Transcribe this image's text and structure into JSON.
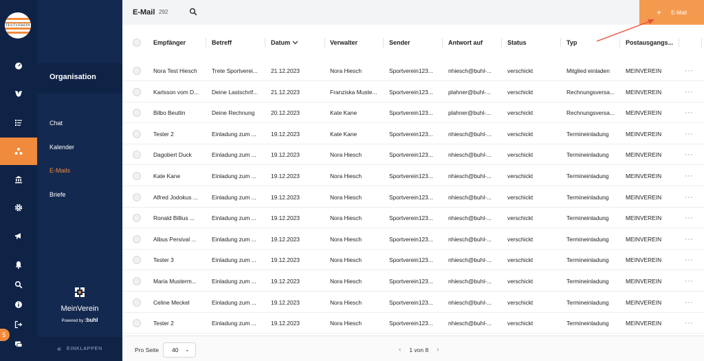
{
  "rail": {
    "logo_text": "TESTVEREIN",
    "badge": "5",
    "icons": [
      "dashboard-icon",
      "members-icon",
      "list-icon",
      "organisation-icon",
      "bank-icon",
      "settings-icon",
      "megaphone-icon",
      "bell-icon",
      "search-icon",
      "info-icon",
      "logout-icon",
      "chat-icon"
    ],
    "active_index": 3
  },
  "sidebar": {
    "title": "Organisation",
    "items": [
      {
        "label": "Chat",
        "active": false
      },
      {
        "label": "Kalender",
        "active": false
      },
      {
        "label": "E-Mails",
        "active": true
      },
      {
        "label": "Briefe",
        "active": false
      }
    ],
    "brand": {
      "name": "MeinVerein",
      "powered_by": "Powered by",
      "company": ":buhl"
    },
    "collapse_label": "EINKLAPPEN"
  },
  "header": {
    "title": "E-Mail",
    "count": "292",
    "add_button_label": "E-Mail"
  },
  "table": {
    "columns": [
      "Empfänger",
      "Betreff",
      "Datum",
      "Verwalter",
      "Sender",
      "Antwort auf",
      "Status",
      "Typ",
      "Postausgangs..."
    ],
    "rows": [
      [
        "Nora Test Hiesch",
        "Trete Sportverei...",
        "21.12.2023",
        "Nora Hiesch",
        "Sportverein123...",
        "nhiesch@buhl-...",
        "verschickt",
        "Mitglied einladen",
        "MEINVEREIN"
      ],
      [
        "Karlsson vom D...",
        "Deine Lastschrif...",
        "21.12.2023",
        "Franziska Muste...",
        "Sportverein123...",
        "plahner@buhl-...",
        "verschickt",
        "Rechnungsversa...",
        "MEINVEREIN"
      ],
      [
        "Bilbo Beutlin",
        "Deine Rechnung",
        "20.12.2023",
        "Kate Kane",
        "Sportverein123...",
        "plahner@buhl-...",
        "verschickt",
        "Rechnungsversa...",
        "MEINVEREIN"
      ],
      [
        "Tester 2",
        "Einladung zum ...",
        "19.12.2023",
        "Kate Kane",
        "Sportverein123...",
        "nhiesch@buhl-...",
        "verschickt",
        "Termineinladung",
        "MEINVEREIN"
      ],
      [
        "Dagobert Duck",
        "Einladung zum ...",
        "19.12.2023",
        "Nora Hiesch",
        "Sportverein123...",
        "nhiesch@buhl-...",
        "verschickt",
        "Termineinladung",
        "MEINVEREIN"
      ],
      [
        "Kate Kane",
        "Einladung zum ...",
        "19.12.2023",
        "Nora Hiesch",
        "Sportverein123...",
        "nhiesch@buhl-...",
        "verschickt",
        "Termineinladung",
        "MEINVEREIN"
      ],
      [
        "Alfred Jodokus ...",
        "Einladung zum ...",
        "19.12.2023",
        "Nora Hiesch",
        "Sportverein123...",
        "nhiesch@buhl-...",
        "verschickt",
        "Termineinladung",
        "MEINVEREIN"
      ],
      [
        "Ronald Billius ...",
        "Einladung zum ...",
        "19.12.2023",
        "Nora Hiesch",
        "Sportverein123...",
        "nhiesch@buhl-...",
        "verschickt",
        "Termineinladung",
        "MEINVEREIN"
      ],
      [
        "Albus Persival ...",
        "Einladung zum ...",
        "19.12.2023",
        "Nora Hiesch",
        "Sportverein123...",
        "nhiesch@buhl-...",
        "verschickt",
        "Termineinladung",
        "MEINVEREIN"
      ],
      [
        "Tester 3",
        "Einladung zum ...",
        "19.12.2023",
        "Nora Hiesch",
        "Sportverein123...",
        "nhiesch@buhl-...",
        "verschickt",
        "Termineinladung",
        "MEINVEREIN"
      ],
      [
        "Maria Musterm...",
        "Einladung zum ...",
        "19.12.2023",
        "Nora Hiesch",
        "Sportverein123...",
        "nhiesch@buhl-...",
        "verschickt",
        "Termineinladung",
        "MEINVEREIN"
      ],
      [
        "Celine Meckel",
        "Einladung zum ...",
        "19.12.2023",
        "Nora Hiesch",
        "Sportverein123...",
        "nhiesch@buhl-...",
        "verschickt",
        "Termineinladung",
        "MEINVEREIN"
      ],
      [
        "Tester 2",
        "Einladung zum ...",
        "19.12.2023",
        "Nora Hiesch",
        "Sportverein123...",
        "nhiesch@buhl-...",
        "verschickt",
        "Termineinladung",
        "MEINVEREIN"
      ]
    ],
    "row_menu_icon": "more-horizontal-icon"
  },
  "footer": {
    "per_page_label": "Pro Seite",
    "per_page_value": "40",
    "pagination": "1 von 8"
  },
  "colors": {
    "accent": "#f08a3c",
    "rail_bg": "#0f2347",
    "sidebar_bg": "#14294f",
    "annotation_arrow": "#e8503a"
  }
}
